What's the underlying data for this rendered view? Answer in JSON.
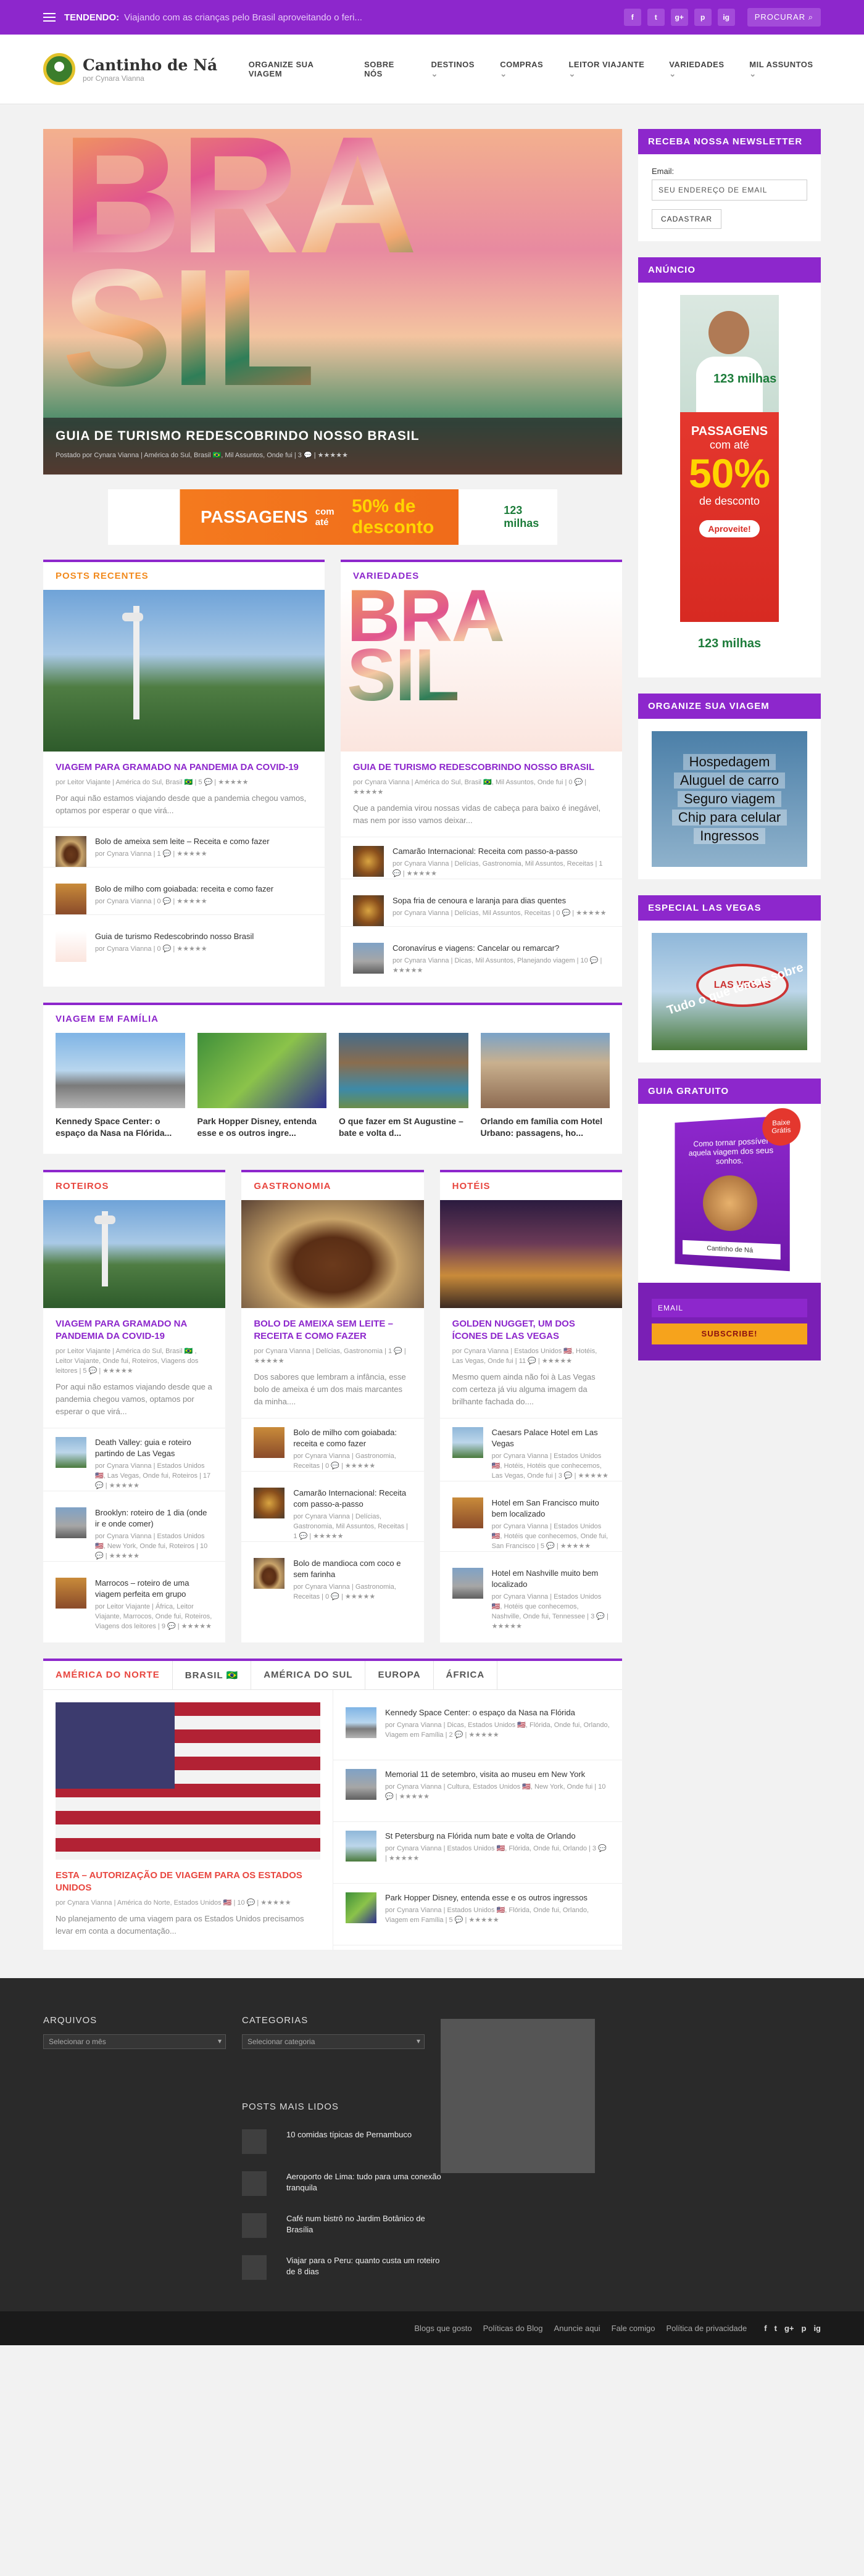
{
  "topbar": {
    "trend_label": "TENDENDO:",
    "trend_text": "Viajando com as crianças pelo Brasil aproveitando o feri...",
    "social": [
      "f",
      "t",
      "g+",
      "p",
      "ig"
    ],
    "search_label": "PROCURAR"
  },
  "header": {
    "logo_title": "Cantinho de Ná",
    "logo_sub": "por Cynara Vianna",
    "nav": [
      {
        "label": "ORGANIZE SUA VIAGEM",
        "dropdown": false
      },
      {
        "label": "SOBRE NÓS",
        "dropdown": false
      },
      {
        "label": "DESTINOS",
        "dropdown": true
      },
      {
        "label": "COMPRAS",
        "dropdown": true
      },
      {
        "label": "LEITOR VIAJANTE",
        "dropdown": true
      },
      {
        "label": "VARIEDADES",
        "dropdown": true
      },
      {
        "label": "MIL ASSUNTOS",
        "dropdown": true
      }
    ]
  },
  "hero": {
    "word": "BRASIL",
    "title": "GUIA DE TURISMO REDESCOBRINDO NOSSO BRASIL",
    "meta": "Postado por Cynara Vianna | América do Sul, Brasil 🇧🇷, Mil Assuntos, Onde fui | 3 💬 | ★★★★★"
  },
  "ad_banner": {
    "l1": "PASSAGENS",
    "l2": "com até",
    "l3": "50% de desconto",
    "brand": "123 milhas"
  },
  "posts_recentes": {
    "title": "POSTS RECENTES",
    "featured": {
      "title": "VIAGEM PARA GRAMADO NA PANDEMIA DA COVID-19",
      "meta": "por Leitor Viajante | América do Sul, Brasil 🇧🇷 | 5 💬 | ★★★★★",
      "excerpt": "Por aqui não estamos viajando desde que a pandemia chegou vamos, optamos por esperar o que virá..."
    },
    "items": [
      {
        "title": "Bolo de ameixa sem leite – Receita e como fazer",
        "meta": "por Cynara Vianna | 1 💬 | ★★★★★"
      },
      {
        "title": "Bolo de milho com goiabada: receita e como fazer",
        "meta": "por Cynara Vianna | 0 💬 | ★★★★★"
      },
      {
        "title": "Guia de turismo Redescobrindo nosso Brasil",
        "meta": "por Cynara Vianna | 0 💬 | ★★★★★"
      }
    ]
  },
  "variedades": {
    "title": "VARIEDADES",
    "featured": {
      "title": "GUIA DE TURISMO REDESCOBRINDO NOSSO BRASIL",
      "meta": "por Cynara Vianna | América do Sul, Brasil 🇧🇷, Mil Assuntos, Onde fui | 0 💬 | ★★★★★",
      "excerpt": "Que a pandemia virou nossas vidas de cabeça para baixo é inegável, mas nem por isso vamos deixar..."
    },
    "items": [
      {
        "title": "Camarão Internacional: Receita com passo-a-passo",
        "meta": "por Cynara Vianna | Delícias, Gastronomia, Mil Assuntos, Receitas | 1 💬 | ★★★★★"
      },
      {
        "title": "Sopa fria de cenoura e laranja para dias quentes",
        "meta": "por Cynara Vianna | Delícias, Mil Assuntos, Receitas | 0 💬 | ★★★★★"
      },
      {
        "title": "Coronavírus e viagens: Cancelar ou remarcar?",
        "meta": "por Cynara Vianna | Dicas, Mil Assuntos, Planejando viagem | 10 💬 | ★★★★★"
      }
    ]
  },
  "familia": {
    "title": "VIAGEM EM FAMÍLIA",
    "items": [
      {
        "caption": "Kennedy Space Center: o espaço da Nasa na Flórida..."
      },
      {
        "caption": "Park Hopper Disney, entenda esse e os outros ingre..."
      },
      {
        "caption": "O que fazer em St Augustine – bate e volta d..."
      },
      {
        "caption": "Orlando em família com Hotel Urbano: passagens, ho..."
      }
    ]
  },
  "roteiros": {
    "title": "ROTEIROS",
    "featured": {
      "title": "VIAGEM PARA GRAMADO NA PANDEMIA DA COVID-19",
      "meta": "por Leitor Viajante | América do Sul, Brasil 🇧🇷 , Leitor Viajante, Onde fui, Roteiros, Viagens dos leitores | 5 💬 | ★★★★★",
      "excerpt": "Por aqui não estamos viajando desde que a pandemia chegou vamos, optamos por esperar o que virá..."
    },
    "items": [
      {
        "title": "Death Valley: guia e roteiro partindo de Las Vegas",
        "meta": "por Cynara Vianna | Estados Unidos 🇺🇸, Las Vegas, Onde fui, Roteiros | 17 💬 | ★★★★★"
      },
      {
        "title": "Brooklyn: roteiro de 1 dia (onde ir e onde comer)",
        "meta": "por Cynara Vianna | Estados Unidos 🇺🇸, New York, Onde fui, Roteiros | 10 💬 | ★★★★★"
      },
      {
        "title": "Marrocos – roteiro de uma viagem perfeita em grupo",
        "meta": "por Leitor Viajante | África, Leitor Viajante, Marrocos, Onde fui, Roteiros, Viagens dos leitores | 9 💬 | ★★★★★"
      }
    ]
  },
  "gastronomia": {
    "title": "GASTRONOMIA",
    "featured": {
      "title": "BOLO DE AMEIXA SEM LEITE – RECEITA E COMO FAZER",
      "meta": "por Cynara Vianna | Delícias, Gastronomia | 1 💬 | ★★★★★",
      "excerpt": "Dos sabores que lembram a infância, esse bolo de ameixa é um dos mais marcantes da minha...."
    },
    "items": [
      {
        "title": "Bolo de milho com goiabada: receita e como fazer",
        "meta": "por Cynara Vianna | Gastronomia, Receitas | 0 💬 | ★★★★★"
      },
      {
        "title": "Camarão Internacional: Receita com passo-a-passo",
        "meta": "por Cynara Vianna | Delícias, Gastronomia, Mil Assuntos, Receitas | 1 💬 | ★★★★★"
      },
      {
        "title": "Bolo de mandioca com coco e sem farinha",
        "meta": "por Cynara Vianna | Gastronomia, Receitas | 0 💬 | ★★★★★"
      }
    ]
  },
  "hoteis": {
    "title": "HOTÉIS",
    "featured": {
      "title": "GOLDEN NUGGET, UM DOS ÍCONES DE LAS VEGAS",
      "meta": "por Cynara Vianna | Estados Unidos 🇺🇸, Hotéis, Las Vegas, Onde fui | 11 💬 | ★★★★★",
      "excerpt": "Mesmo quem ainda não foi à Las Vegas com certeza já viu alguma imagem da brilhante fachada do...."
    },
    "items": [
      {
        "title": "Caesars Palace Hotel em Las Vegas",
        "meta": "por Cynara Vianna | Estados Unidos 🇺🇸, Hotéis, Hotéis que conhecemos, Las Vegas, Onde fui | 3 💬 | ★★★★★"
      },
      {
        "title": "Hotel em San Francisco muito bem localizado",
        "meta": "por Cynara Vianna | Estados Unidos 🇺🇸, Hotéis que conhecemos, Onde fui, San Francisco | 5 💬 | ★★★★★"
      },
      {
        "title": "Hotel em Nashville muito bem localizado",
        "meta": "por Cynara Vianna | Estados Unidos 🇺🇸, Hotéis que conhecemos, Nashville, Onde fui, Tennessee | 3 💬 | ★★★★★"
      }
    ]
  },
  "tabs": {
    "labels": [
      "AMÉRICA DO NORTE",
      "BRASIL 🇧🇷",
      "AMÉRICA DO SUL",
      "EUROPA",
      "ÁFRICA"
    ],
    "featured": {
      "title": "ESTA – AUTORIZAÇÃO DE VIAGEM PARA OS ESTADOS UNIDOS",
      "meta": "por Cynara Vianna | América do Norte, Estados Unidos 🇺🇸 | 10 💬 | ★★★★★",
      "excerpt": "No planejamento de uma viagem para os Estados Unidos precisamos levar em conta a documentação..."
    },
    "items": [
      {
        "title": "Kennedy Space Center: o espaço da Nasa na Flórida",
        "meta": "por Cynara Vianna | Dicas, Estados Unidos 🇺🇸, Flórida, Onde fui, Orlando, Viagem em Família | 2 💬 | ★★★★★"
      },
      {
        "title": "Memorial 11 de setembro, visita ao museu em New York",
        "meta": "por Cynara Vianna | Cultura, Estados Unidos 🇺🇸, New York, Onde fui | 10 💬 | ★★★★★"
      },
      {
        "title": "St Petersburg na Flórida num bate e volta de Orlando",
        "meta": "por Cynara Vianna | Estados Unidos 🇺🇸, Flórida, Onde fui, Orlando | 3 💬 | ★★★★★"
      },
      {
        "title": "Park Hopper Disney, entenda esse e os outros ingressos",
        "meta": "por Cynara Vianna | Estados Unidos 🇺🇸, Flórida, Onde fui, Orlando, Viagem em Família | 5 💬 | ★★★★★"
      }
    ]
  },
  "sidebar": {
    "newsletter_title": "RECEBA NOSSA NEWSLETTER",
    "email_label": "Email:",
    "email_placeholder": "SEU ENDEREÇO DE EMAIL",
    "subscribe_label": "CADASTRAR",
    "ad_title": "ANÚNCIO",
    "ad": {
      "brand": "123 milhas",
      "l1": "PASSAGENS",
      "l2": "com até",
      "l3": "50%",
      "l4": "de desconto",
      "cta": "Aproveite!",
      "bottom": "123 milhas"
    },
    "organize_title": "ORGANIZE SUA VIAGEM",
    "organize_items": [
      "Hospedagem",
      "Aluguel de carro",
      "Seguro viagem",
      "Chip para celular",
      "Ingressos"
    ],
    "lasvegas_title": "ESPECIAL LAS VEGAS",
    "lasvegas_sign": "LAS VEGAS",
    "lasvegas_text": "Tudo o que temos sobre",
    "guide_title": "GUIA GRATUITO",
    "guide_cover": "Como tornar possível aquela viagem dos seus sonhos.",
    "guide_badge": "Baixe Grátis",
    "guide_brand": "Cantinho de Ná",
    "sub_email": "EMAIL",
    "sub_button": "SUBSCRIBE!"
  },
  "footer": {
    "archives_title": "ARQUIVOS",
    "archives_select": "Selecionar o mês",
    "categories_title": "CATEGORIAS",
    "categories_select": "Selecionar categoria",
    "popular_title": "POSTS MAIS LIDOS",
    "popular": [
      "10 comidas típicas de Pernambuco",
      "Aeroporto de Lima: tudo para uma conexão tranquila",
      "Café num bistrô no Jardim Botânico de Brasília",
      "Viajar para o Peru: quanto custa um roteiro de 8 dias"
    ],
    "links": [
      "Blogs que gosto",
      "Políticas do Blog",
      "Anuncie aqui",
      "Fale comigo",
      "Política de privacidade"
    ],
    "social": [
      "f",
      "t",
      "g+",
      "p",
      "ig"
    ]
  }
}
